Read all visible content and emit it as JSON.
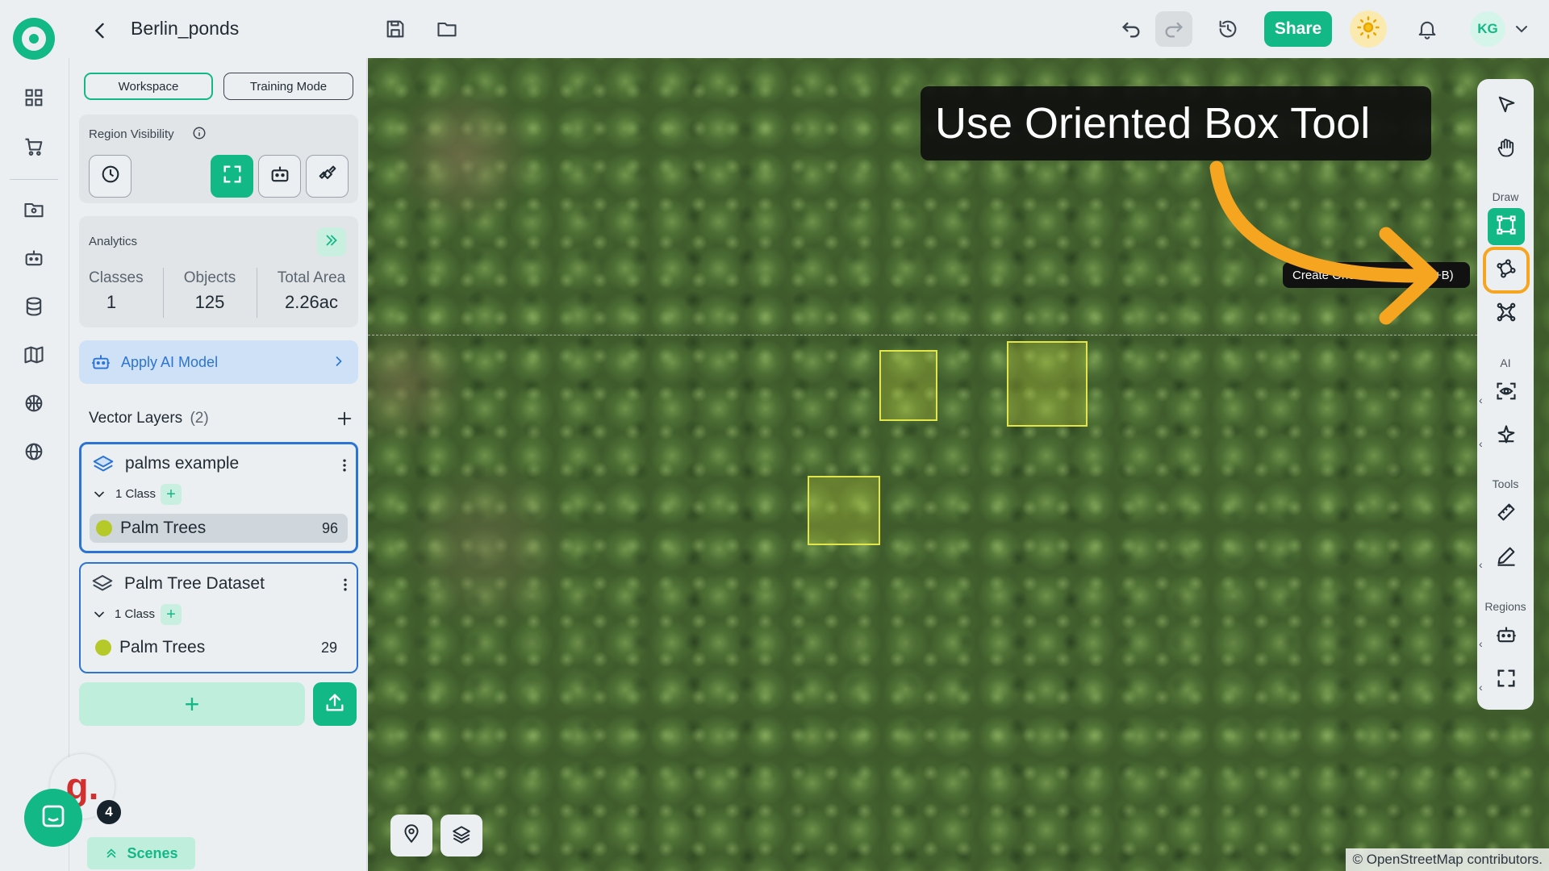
{
  "header": {
    "project_title": "Berlin_ponds",
    "share_label": "Share",
    "avatar_initials": "KG"
  },
  "panel": {
    "mode_tabs": [
      "Workspace",
      "Training Mode"
    ],
    "region_visibility_label": "Region Visibility",
    "analytics": {
      "title": "Analytics",
      "stats": [
        {
          "label": "Classes",
          "value": "1"
        },
        {
          "label": "Objects",
          "value": "125"
        },
        {
          "label": "Total Area",
          "value": "2.26ac"
        }
      ]
    },
    "apply_ai_label": "Apply AI Model",
    "vector_layers_title": "Vector Layers",
    "vector_layers_count": "(2)",
    "layers": [
      {
        "name": "palms example",
        "class_count": "1 Class",
        "class_name": "Palm Trees",
        "class_total": "96"
      },
      {
        "name": "Palm Tree Dataset",
        "class_count": "1 Class",
        "class_name": "Palm Trees",
        "class_total": "29"
      }
    ],
    "scenes_label": "Scenes",
    "notification_count": "4",
    "g_logo_text": "g."
  },
  "map": {
    "callout_text": "Use Oriented Box Tool",
    "tooltip_text": "Create Oriented Box (Shift+B)",
    "attribution": "© OpenStreetMap contributors.",
    "annotation_color": "#e3e64a",
    "arrow_color": "#f6a521"
  },
  "right_toolbar": {
    "sections": [
      "Draw",
      "AI",
      "Tools",
      "Regions"
    ]
  },
  "colors": {
    "accent": "#12b886",
    "selection_blue": "#2b74d6",
    "highlight_orange": "#f6a521",
    "class_color": "#b5c928"
  }
}
